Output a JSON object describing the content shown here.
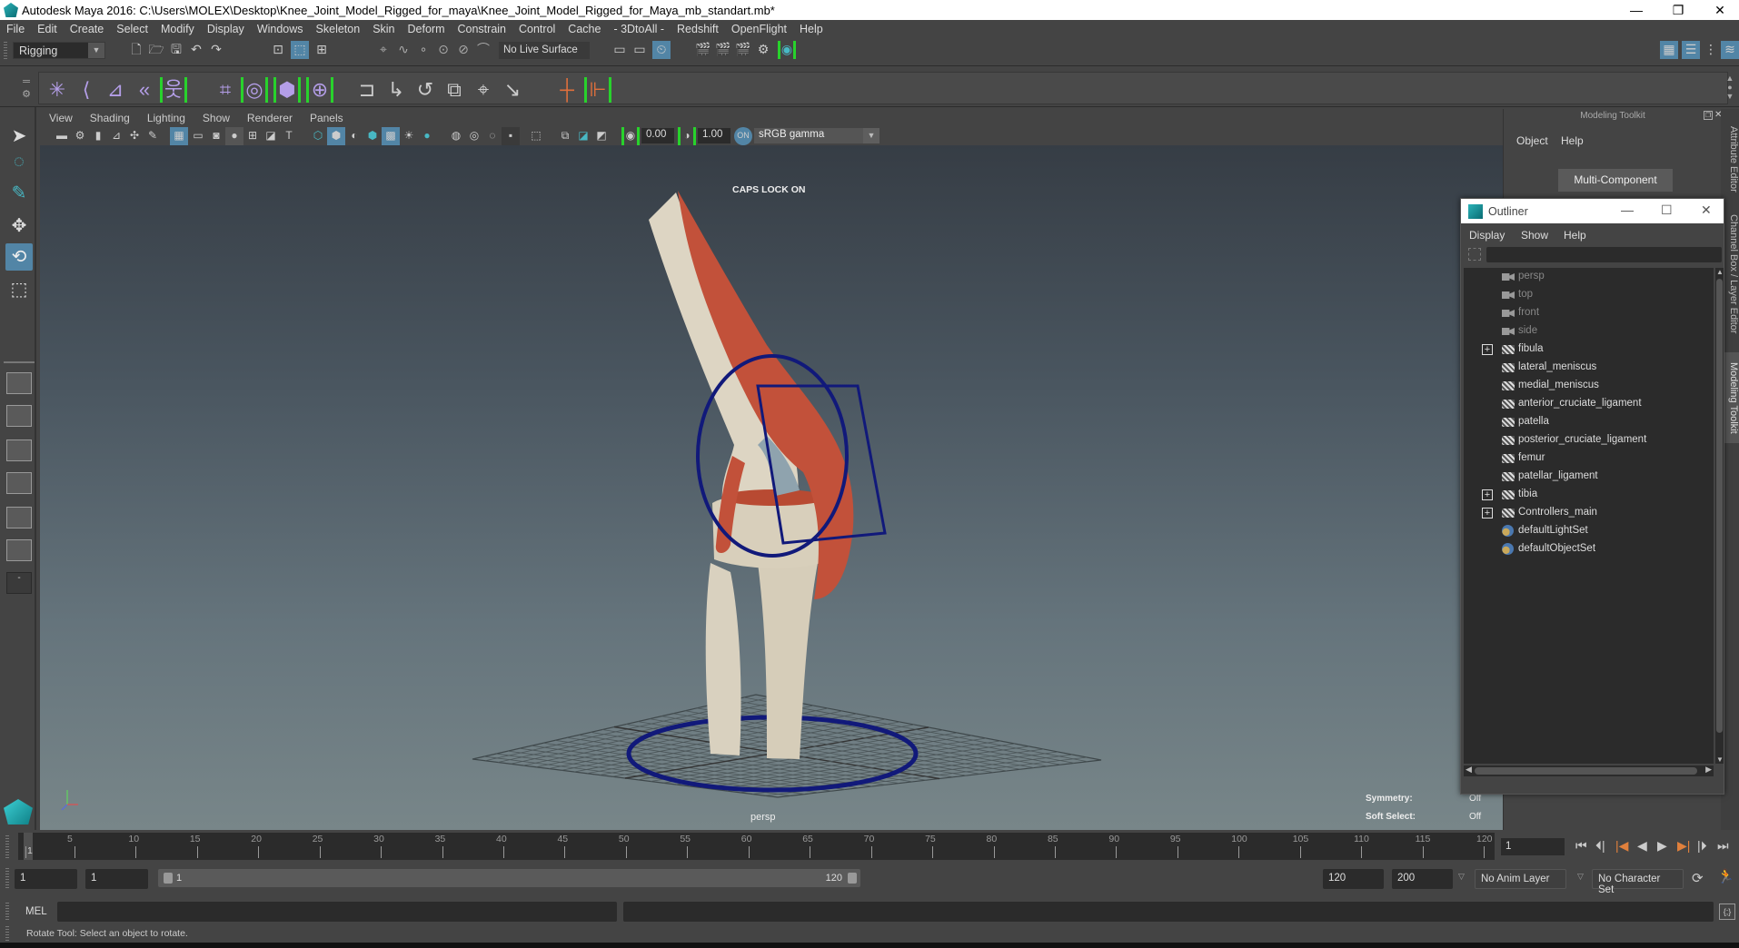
{
  "window": {
    "title": "Autodesk Maya 2016: C:\\Users\\MOLEX\\Desktop\\Knee_Joint_Model_Rigged_for_maya\\Knee_Joint_Model_Rigged_for_Maya_mb_standart.mb*",
    "minimize": "—",
    "restore": "❐",
    "close": "✕"
  },
  "menubar": [
    "File",
    "Edit",
    "Create",
    "Select",
    "Modify",
    "Display",
    "Windows",
    "Skeleton",
    "Skin",
    "Deform",
    "Constrain",
    "Control",
    "Cache",
    "- 3DtoAll -",
    "Redshift",
    "OpenFlight",
    "Help"
  ],
  "statusline": {
    "menuset": "Rigging",
    "live_surface": "No Live Surface"
  },
  "shelf": {
    "icons": [
      "joint-tool-icon",
      "ik-handle-icon",
      "ik-spline-icon",
      "insert-joint-icon",
      "human-ik-icon",
      "paint-weights-icon",
      "bind-skin-icon",
      "lattice-icon",
      "cluster-icon",
      "parent-constraint-icon",
      "point-constraint-icon",
      "orient-constraint-icon",
      "scale-constraint-icon",
      "aim-constraint-icon",
      "pole-vector-icon",
      "add-attribute-icon",
      "reference-editor-icon"
    ]
  },
  "viewport": {
    "menu": [
      "View",
      "Shading",
      "Lighting",
      "Show",
      "Renderer",
      "Panels"
    ],
    "exposure": "0.00",
    "gamma": "1.00",
    "color_space": "sRGB gamma",
    "caps_lock": "CAPS LOCK ON",
    "camera": "persp",
    "hud": {
      "symmetry_label": "Symmetry:",
      "symmetry_value": "Off",
      "soft_select_label": "Soft Select:",
      "soft_select_value": "Off"
    }
  },
  "modeling_toolkit": {
    "title": "Modeling Toolkit",
    "menu": [
      "Object",
      "Help"
    ],
    "multi_component": "Multi-Component"
  },
  "side_tabs": [
    "Attribute Editor",
    "Channel Box / Layer Editor",
    "Modeling Toolkit"
  ],
  "outliner": {
    "title": "Outliner",
    "menu": [
      "Display",
      "Show",
      "Help"
    ],
    "items": [
      {
        "name": "persp",
        "type": "camera",
        "expandable": false
      },
      {
        "name": "top",
        "type": "camera",
        "expandable": false
      },
      {
        "name": "front",
        "type": "camera",
        "expandable": false
      },
      {
        "name": "side",
        "type": "camera",
        "expandable": false
      },
      {
        "name": "fibula",
        "type": "mesh",
        "expandable": true
      },
      {
        "name": "lateral_meniscus",
        "type": "mesh",
        "expandable": false
      },
      {
        "name": "medial_meniscus",
        "type": "mesh",
        "expandable": false
      },
      {
        "name": "anterior_cruciate_ligament",
        "type": "mesh",
        "expandable": false
      },
      {
        "name": "patella",
        "type": "mesh",
        "expandable": false
      },
      {
        "name": "posterior_cruciate_ligament",
        "type": "mesh",
        "expandable": false
      },
      {
        "name": "femur",
        "type": "mesh",
        "expandable": false
      },
      {
        "name": "patellar_ligament",
        "type": "mesh",
        "expandable": false
      },
      {
        "name": "tibia",
        "type": "mesh",
        "expandable": true
      },
      {
        "name": "Controllers_main",
        "type": "mesh",
        "expandable": true
      },
      {
        "name": "defaultLightSet",
        "type": "set",
        "expandable": false
      },
      {
        "name": "defaultObjectSet",
        "type": "set",
        "expandable": false
      }
    ]
  },
  "timeline": {
    "ticks": [
      "1",
      "5",
      "10",
      "15",
      "20",
      "25",
      "30",
      "35",
      "40",
      "45",
      "50",
      "55",
      "60",
      "65",
      "70",
      "75",
      "80",
      "85",
      "90",
      "95",
      "100",
      "105",
      "110",
      "115",
      "120"
    ],
    "current_frame": "1"
  },
  "range": {
    "start": "1",
    "playback_start": "1",
    "slider_start": "1",
    "slider_end": "120",
    "playback_end": "120",
    "end": "200",
    "anim_layer": "No Anim Layer",
    "character_set": "No Character Set"
  },
  "command_line": {
    "language": "MEL",
    "value": ""
  },
  "help_line": "Rotate Tool: Select an object to rotate.",
  "colors": {
    "accent_blue": "#5285a6",
    "maya_teal": "#2bb3b8",
    "muscle": "#c2513a",
    "controller": "#0f1a7a"
  }
}
